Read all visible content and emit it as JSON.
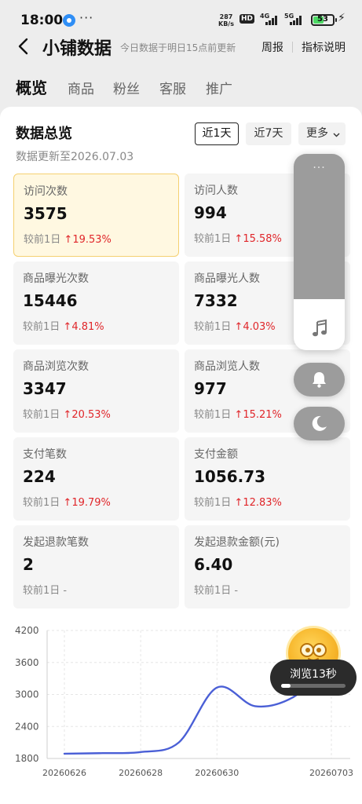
{
  "status_bar": {
    "time": "18:00",
    "more": "···",
    "net_speed_value": "287",
    "net_speed_unit": "KB/s",
    "hd": "HD",
    "net1": "4G",
    "net2": "5G",
    "battery": "53",
    "battery_level": 0.53
  },
  "header": {
    "title": "小铺数据",
    "subtitle": "今日数据于明日15点前更新",
    "weekly": "周报",
    "metric_desc": "指标说明"
  },
  "tabs": [
    "概览",
    "商品",
    "粉丝",
    "客服",
    "推广"
  ],
  "overview": {
    "title": "数据总览",
    "updated": "数据更新至2026.07.03",
    "ranges": [
      "近1天",
      "近7天",
      "更多"
    ],
    "selected_range": "近1天"
  },
  "metrics": [
    {
      "label": "访问次数",
      "value": "3575",
      "compare": "较前1日",
      "change": "19.53%",
      "trend": "up"
    },
    {
      "label": "访问人数",
      "value": "994",
      "compare": "较前1日",
      "change": "15.58%",
      "trend": "up"
    },
    {
      "label": "商品曝光次数",
      "value": "15446",
      "compare": "较前1日",
      "change": "4.81%",
      "trend": "up"
    },
    {
      "label": "商品曝光人数",
      "value": "7332",
      "compare": "较前1日",
      "change": "4.03%",
      "trend": "up"
    },
    {
      "label": "商品浏览次数",
      "value": "3347",
      "compare": "较前1日",
      "change": "20.53%",
      "trend": "up"
    },
    {
      "label": "商品浏览人数",
      "value": "977",
      "compare": "较前1日",
      "change": "15.21%",
      "trend": "up"
    },
    {
      "label": "支付笔数",
      "value": "224",
      "compare": "较前1日",
      "change": "19.79%",
      "trend": "up"
    },
    {
      "label": "支付金额",
      "value": "1056.73",
      "compare": "较前1日",
      "change": "12.83%",
      "trend": "up"
    },
    {
      "label": "发起退款笔数",
      "value": "2",
      "compare": "较前1日",
      "change": "-",
      "trend": "none"
    },
    {
      "label": "发起退款金额(元)",
      "value": "6.40",
      "compare": "较前1日",
      "change": "-",
      "trend": "none"
    }
  ],
  "chart_data": {
    "type": "line",
    "x": [
      "20260626",
      "20260627",
      "20260628",
      "20260629",
      "20260630",
      "20260701",
      "20260702",
      "20260703"
    ],
    "x_tick_labels": [
      "20260626",
      "20260628",
      "20260630",
      "20260703"
    ],
    "y_ticks": [
      1800,
      2400,
      3000,
      3600,
      4200
    ],
    "ylim": [
      1800,
      4200
    ],
    "series": [
      {
        "values": [
          1890,
          1900,
          1920,
          2100,
          3130,
          2780,
          2950,
          3575
        ],
        "color": "#4a5fd6"
      }
    ],
    "grid": true
  },
  "float_controls": {
    "dots": "···"
  },
  "browse_timer": {
    "label": "浏览13秒",
    "progress": 0.15
  },
  "colors": {
    "accent_up": "#e0262a",
    "highlight_card": "#fff8e1",
    "line": "#4a5fd6"
  }
}
